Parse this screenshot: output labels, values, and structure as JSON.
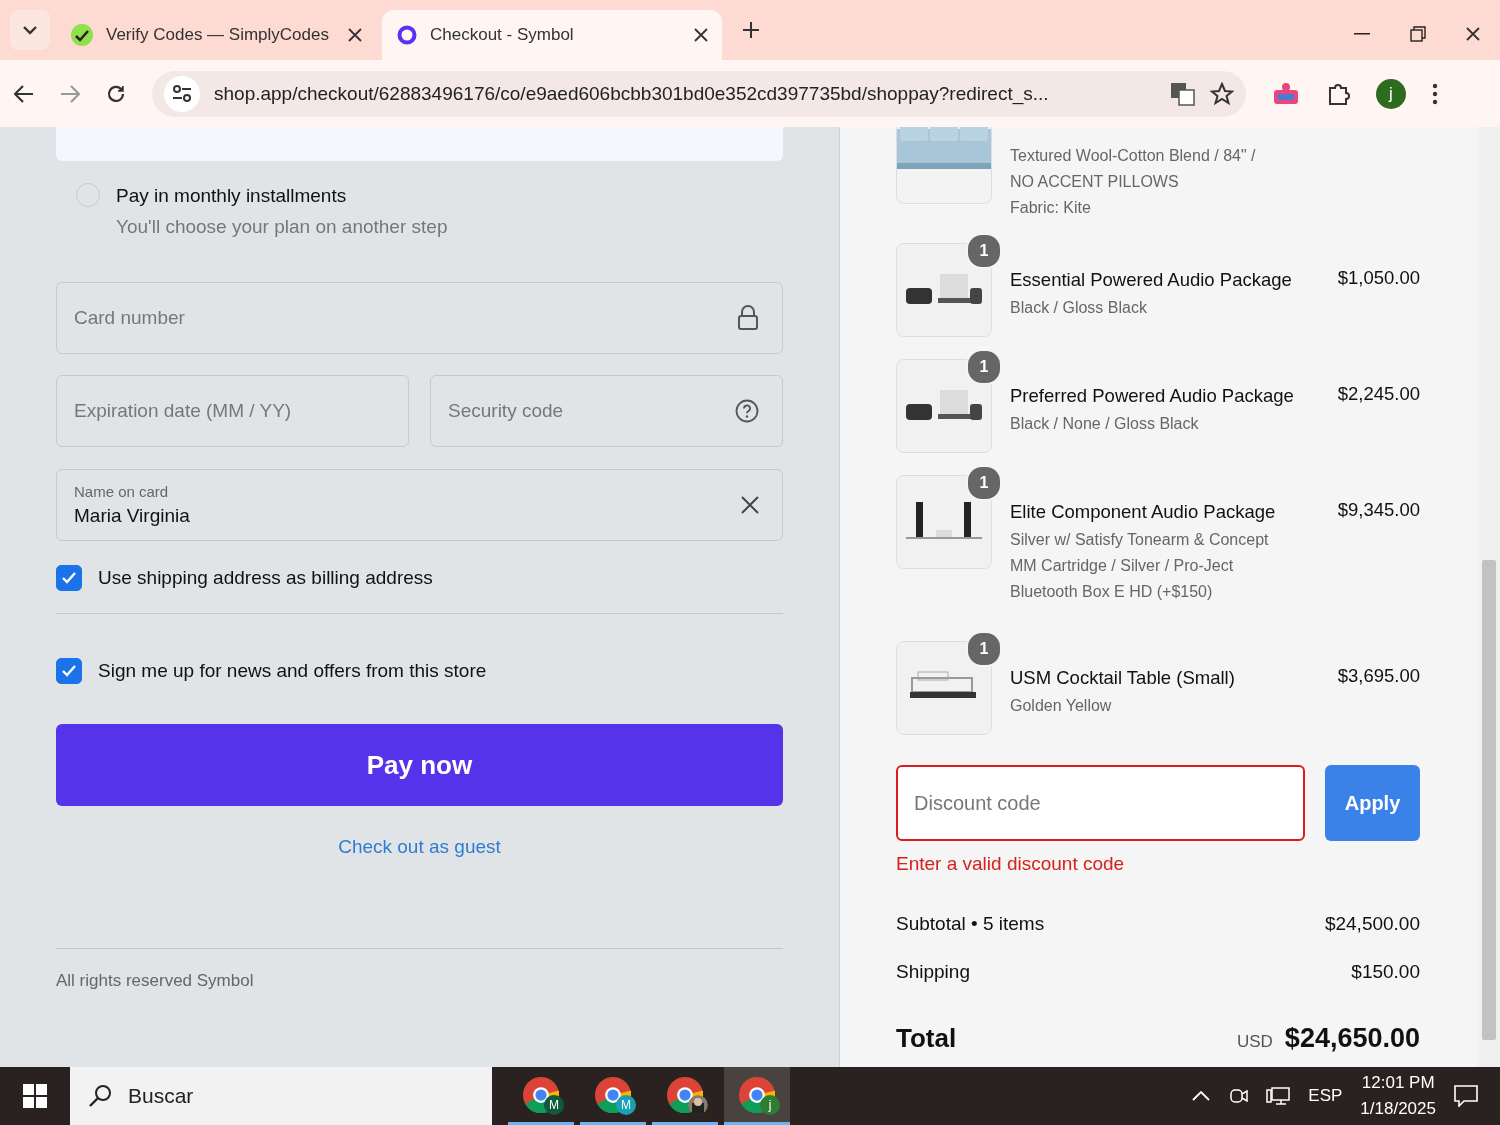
{
  "browser": {
    "tabs": [
      {
        "title": "Verify Codes — SimplyCodes",
        "selected": false
      },
      {
        "title": "Checkout - Symbol",
        "selected": true
      }
    ],
    "url": "shop.app/checkout/62883496176/co/e9aed606bcbb301bd0e352cd397735bd/shoppay?redirect_s...",
    "profile": "j"
  },
  "payment": {
    "options": [
      {
        "selected": true
      },
      {
        "label": "Pay in monthly installments",
        "description": "You'll choose your plan on another step",
        "selected": false
      }
    ],
    "card_number": {
      "placeholder": "Card number"
    },
    "expiration": {
      "placeholder": "Expiration date (MM / YY)"
    },
    "security_code": {
      "placeholder": "Security code"
    },
    "name_on_card": {
      "label": "Name on card",
      "value": "Maria Virginia"
    },
    "checkboxes": [
      {
        "label": "Use shipping address as billing address",
        "checked": true
      },
      {
        "label": "Sign me up for news and offers from this store",
        "checked": true
      }
    ],
    "pay_button": "Pay now",
    "guest_link": "Check out as guest",
    "footer": "All rights reserved Symbol"
  },
  "summary": {
    "items": [
      {
        "kind": "sofa",
        "variants": [
          "Textured Wool-Cotton Blend / 84\" /",
          "NO ACCENT PILLOWS",
          "Fabric: Kite"
        ]
      },
      {
        "kind": "audio",
        "quantity": "1",
        "name": "Essential Powered Audio Package",
        "price": "$1,050.00",
        "variants": [
          "Black / Gloss Black"
        ]
      },
      {
        "kind": "audio",
        "quantity": "1",
        "name": "Preferred Powered Audio Package",
        "price": "$2,245.00",
        "variants": [
          "Black / None / Gloss Black"
        ]
      },
      {
        "kind": "speakers",
        "quantity": "1",
        "name": "Elite Component Audio Package",
        "price": "$9,345.00",
        "variants": [
          "Silver w/ Satisfy Tonearm & Concept",
          "MM Cartridge / Silver / Pro-Ject",
          "Bluetooth Box E HD (+$150)"
        ]
      },
      {
        "kind": "table",
        "quantity": "1",
        "name": "USM Cocktail Table (Small)",
        "price": "$3,695.00",
        "variants": [
          "Golden Yellow"
        ]
      }
    ],
    "discount": {
      "placeholder": "Discount code",
      "invalid": true,
      "error": "Enter a valid discount code",
      "apply": "Apply"
    },
    "subtotal": {
      "label": "Subtotal • 5 items",
      "value": "$24,500.00"
    },
    "shipping": {
      "label": "Shipping",
      "value": "$150.00"
    },
    "total": {
      "label": "Total",
      "currency": "USD",
      "value": "$24,650.00"
    }
  },
  "taskbar": {
    "search": "Buscar",
    "apps": [
      {
        "badge": "M",
        "color": "#0f5a3c",
        "selected": false
      },
      {
        "badge": "M",
        "color": "#1aa0b4",
        "selected": false
      },
      {
        "kind": "picture",
        "selected": false
      },
      {
        "badge": "j",
        "color": "#2e7d32",
        "selected": true
      }
    ],
    "language": "ESP",
    "time": "12:01 PM",
    "date": "1/18/2025"
  }
}
